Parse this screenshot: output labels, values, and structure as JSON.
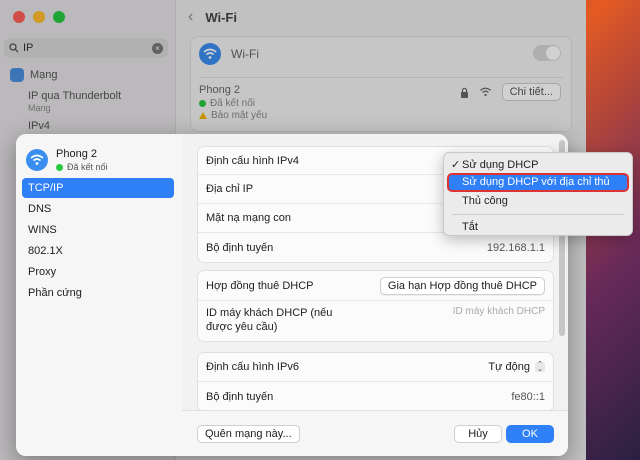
{
  "background": {
    "search_value": "IP",
    "sidebar": {
      "network_label": "Mạng",
      "thunderbolt_label": "IP qua Thunderbolt",
      "thunderbolt_sub": "Mạng",
      "ipv4_label": "IPv4"
    },
    "header_title": "Wi-Fi",
    "card": {
      "wifi_label": "Wi-Fi",
      "network_name": "Phong 2",
      "status_connected": "Đã kết nối",
      "security_warning": "Bảo mật yếu",
      "details_button": "Chi tiết..."
    }
  },
  "sheet": {
    "network_name": "Phong 2",
    "network_status": "Đã kết nối",
    "nav_items": [
      {
        "label": "TCP/IP",
        "active": true
      },
      {
        "label": "DNS"
      },
      {
        "label": "WINS"
      },
      {
        "label": "802.1X"
      },
      {
        "label": "Proxy"
      },
      {
        "label": "Phần cứng"
      }
    ],
    "ipv4_group": {
      "configure_label": "Định cấu hình IPv4",
      "ip_address_label": "Địa chỉ IP",
      "subnet_label": "Mặt nạ mạng con",
      "router_label": "Bộ định tuyến",
      "router_value": "192.168.1.1"
    },
    "dhcp_group": {
      "lease_label": "Hợp đồng thuê DHCP",
      "renew_button": "Gia hạn Hợp đồng thuê DHCP",
      "client_id_label": "ID máy khách DHCP (nếu được yêu cầu)",
      "client_id_placeholder": "ID máy khách DHCP"
    },
    "ipv6_group": {
      "configure_label": "Định cấu hình IPv6",
      "configure_value": "Tự động",
      "router_label": "Bộ định tuyến",
      "router_value": "fe80::1"
    },
    "footer": {
      "forget_button": "Quên mạng này...",
      "cancel_button": "Hủy",
      "ok_button": "OK"
    }
  },
  "dropdown": {
    "items": [
      {
        "label": "Sử dụng DHCP",
        "checked": true
      },
      {
        "label": "Sử dụng DHCP với địa chỉ thủ công",
        "highlighted": true
      },
      {
        "label": "Thủ công"
      },
      {
        "label": "Tắt"
      }
    ]
  },
  "colors": {
    "accent": "#2f7ff6",
    "highlight_border": "#dd3333",
    "status_green": "#28c840"
  }
}
